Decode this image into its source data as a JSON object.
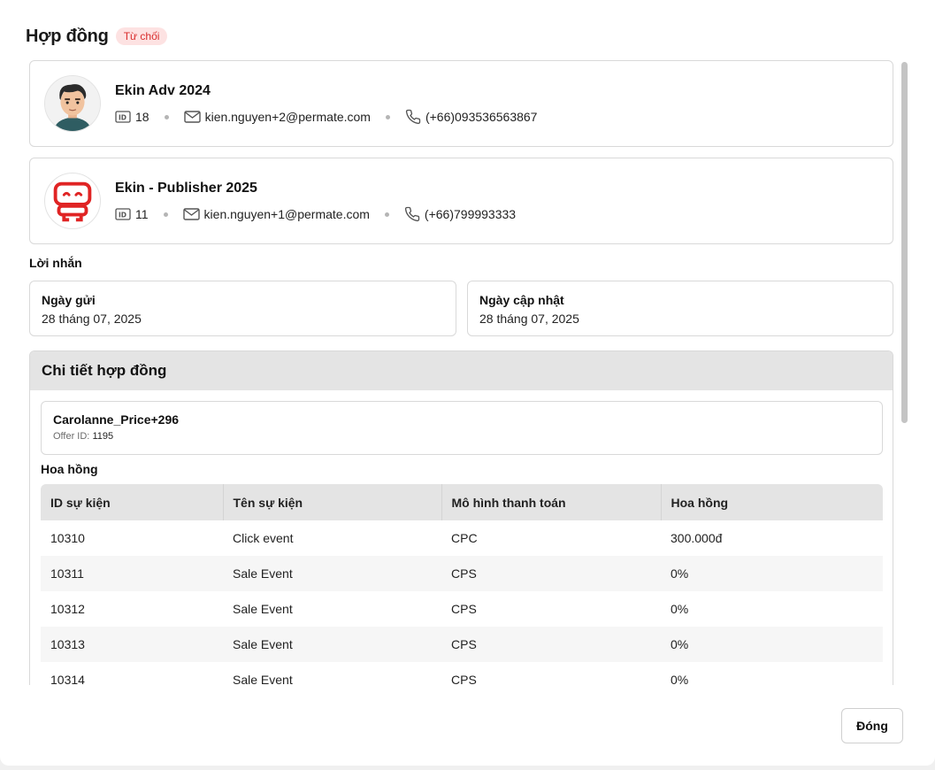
{
  "header": {
    "title": "Hợp đồng",
    "status_badge": "Từ chối"
  },
  "parties": [
    {
      "name": "Ekin Adv 2024",
      "id": "18",
      "email": "kien.nguyen+2@permate.com",
      "phone": "(+66)093536563867",
      "avatar": "man-avatar-icon"
    },
    {
      "name": "Ekin - Publisher 2025",
      "id": "11",
      "email": "kien.nguyen+1@permate.com",
      "phone": "(+66)799993333",
      "avatar": "robot-logo-icon"
    }
  ],
  "message_label": "Lời nhắn",
  "dates": {
    "sent_label": "Ngày gửi",
    "sent_value": "28 tháng 07, 2025",
    "updated_label": "Ngày cập nhật",
    "updated_value": "28 tháng 07, 2025"
  },
  "details": {
    "title": "Chi tiết hợp đồng",
    "offer_name": "Carolanne_Price+296",
    "offer_id_label": "Offer ID:",
    "offer_id": "1195",
    "commission_label": "Hoa hồng",
    "columns": [
      "ID sự kiện",
      "Tên sự kiện",
      "Mô hình thanh toán",
      "Hoa hồng"
    ],
    "rows": [
      [
        "10310",
        "Click event",
        "CPC",
        "300.000đ"
      ],
      [
        "10311",
        "Sale Event",
        "CPS",
        "0%"
      ],
      [
        "10312",
        "Sale Event",
        "CPS",
        "0%"
      ],
      [
        "10313",
        "Sale Event",
        "CPS",
        "0%"
      ],
      [
        "10314",
        "Sale Event",
        "CPS",
        "0%"
      ]
    ]
  },
  "footer": {
    "close_label": "Đóng"
  },
  "colors": {
    "badge_bg": "#fde2e2",
    "badge_text": "#d92d2d",
    "robot_red": "#e02424"
  }
}
